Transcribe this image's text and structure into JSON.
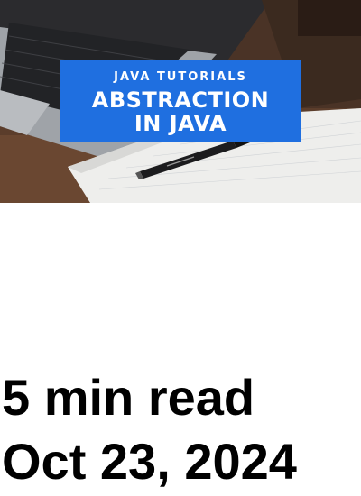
{
  "hero": {
    "banner_kicker": "JAVA TUTORIALS",
    "banner_title_line1": "ABSTRACTION",
    "banner_title_line2": "IN JAVA",
    "banner_color": "#1f6fe0"
  },
  "meta": {
    "read_time": "5 min read",
    "date": "Oct 23, 2024"
  }
}
